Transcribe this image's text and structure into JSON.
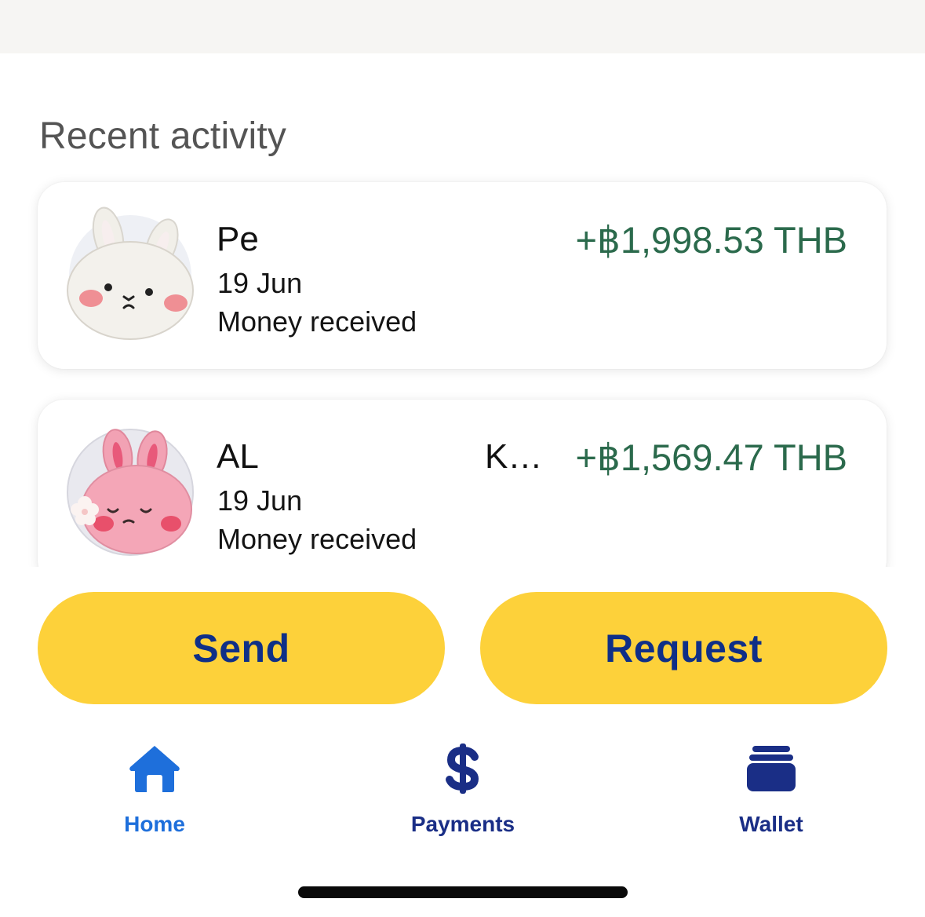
{
  "section_title": "Recent activity",
  "activity": [
    {
      "name": "Pe",
      "name_tail": "",
      "date": "19 Jun",
      "type": "Money received",
      "amount": "+฿1,998.53 THB"
    },
    {
      "name": "AL",
      "name_tail": "K…",
      "date": "19 Jun",
      "type": "Money received",
      "amount": "+฿1,569.47 THB"
    }
  ],
  "actions": {
    "send_label": "Send",
    "request_label": "Request"
  },
  "nav": {
    "home_label": "Home",
    "payments_label": "Payments",
    "wallet_label": "Wallet"
  },
  "colors": {
    "accent_yellow": "#fdd13a",
    "button_text_navy": "#0f2f87",
    "amount_green": "#2b6a4c",
    "home_active_blue": "#1e6fdb",
    "nav_navy": "#1a2e86"
  },
  "icons": {
    "home": "home-icon",
    "payments": "dollar-icon",
    "wallet": "wallet-icon"
  }
}
